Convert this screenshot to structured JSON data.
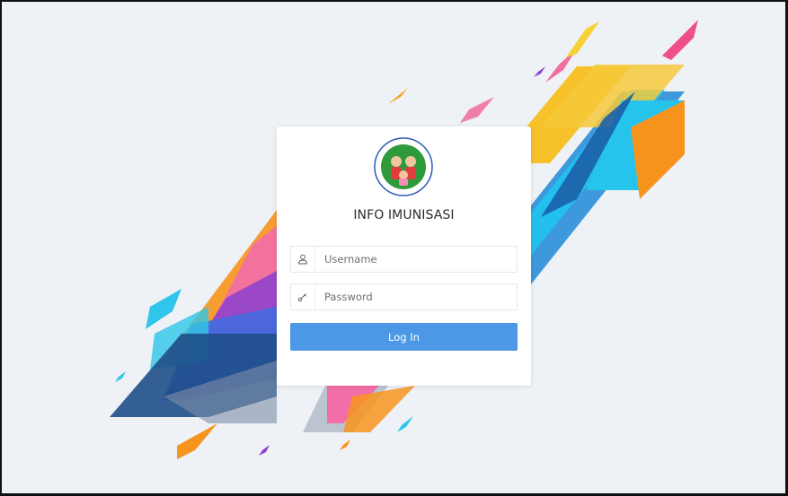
{
  "login": {
    "title": "INFO IMUNISASI",
    "username_placeholder": "Username",
    "password_placeholder": "Password",
    "submit_label": "Log In",
    "username_icon": "user-icon",
    "password_icon": "key-icon"
  },
  "colors": {
    "background": "#eef1f5",
    "card": "#ffffff",
    "button": "#4c98e6",
    "button_text": "#ffffff",
    "title_text": "#2b2b2b"
  }
}
